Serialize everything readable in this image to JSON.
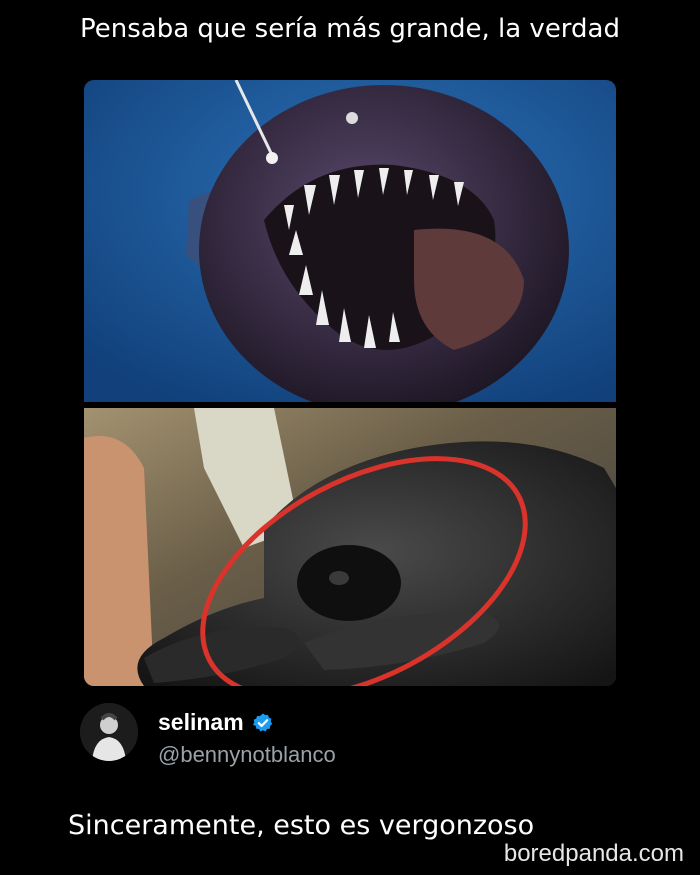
{
  "caption": "Pensaba que sería más grande, la verdad",
  "post": {
    "display_name": "selinam",
    "handle": "@bennynotblanco",
    "verified_icon": "verified-badge-icon",
    "text": "Sinceramente, esto es vergonzoso"
  },
  "watermark": "boredpanda.com",
  "colors": {
    "background": "#000000",
    "ocean_blue": "#1f5fa3",
    "highlight_circle": "#d9332b",
    "verified_blue": "#1d9bf0",
    "handle_gray": "#9aa1a7"
  }
}
